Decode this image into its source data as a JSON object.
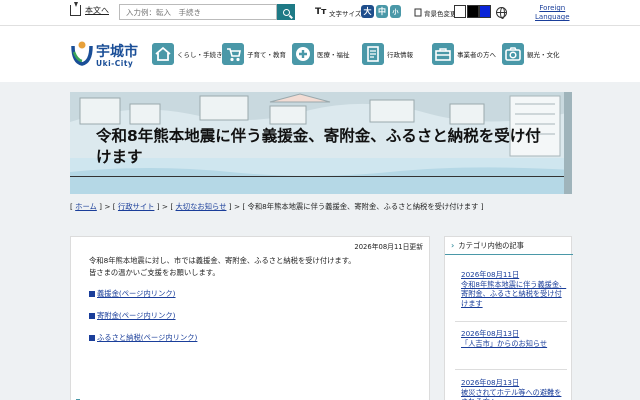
{
  "topbar": {
    "skip_label": "本文へ",
    "search_placeholder": "入力例：転入　手続き",
    "font_size_label": "文字サイズ",
    "font_size_icon": "Tт",
    "font_sizes": [
      "大",
      "中",
      "小"
    ],
    "bg_color_label": "背景色変更",
    "foreign_language_line1": "Foreign",
    "foreign_language_line2": "Language"
  },
  "header": {
    "logo_name": "宇城市",
    "logo_sub": "Uki-City",
    "nav": [
      {
        "label": "くらし・手続き",
        "icon": "house-icon"
      },
      {
        "label": "子育て・教育",
        "icon": "stroller-icon"
      },
      {
        "label": "医療・福祉",
        "icon": "medical-cross-icon"
      },
      {
        "label": "行政情報",
        "icon": "document-icon"
      },
      {
        "label": "事業者の方へ",
        "icon": "briefcase-icon"
      },
      {
        "label": "観光・文化",
        "icon": "camera-icon"
      }
    ]
  },
  "hero": {
    "title": "令和8年熊本地震に伴う義援金、寄附金、ふるさと納税を受け付けます"
  },
  "breadcrumb": {
    "home": "ホーム",
    "gyosei": "行政サイト",
    "important": "大切なお知らせ",
    "current": "令和8年熊本地震に伴う義援金、寄附金、ふるさと納税を受け付けます"
  },
  "article": {
    "updated": "2026年08月11日更新",
    "lead_line1": "令和8年熊本地震に対し、市では義援金、寄附金、ふるさと納税を受け付けます。",
    "lead_line2": "皆さまの温かいご支援をお願いします。",
    "links": [
      "義援金(ページ内リンク)",
      "寄附金(ページ内リンク)",
      "ふるさと納税(ページ内リンク)"
    ]
  },
  "sidebar": {
    "heading": "カテゴリ内他の記事",
    "entries": [
      {
        "date": "2026年08月11日",
        "title": "令和8年熊本地震に伴う義援金、寄附金、ふるさと納税を受け付けます"
      },
      {
        "date": "2026年08月13日",
        "title": "「人吉市」からのお知らせ"
      },
      {
        "date": "2026年08月13日",
        "title": "被災されてホテル等への避難をされる方へ"
      }
    ]
  },
  "colors": {
    "teal": "#1e7a86",
    "accent": "#4a98a8",
    "link": "#1a3e9a",
    "size_large": "#1f4e8c",
    "size_mid": "#4a98a8",
    "size_small": "#4a98a8"
  }
}
